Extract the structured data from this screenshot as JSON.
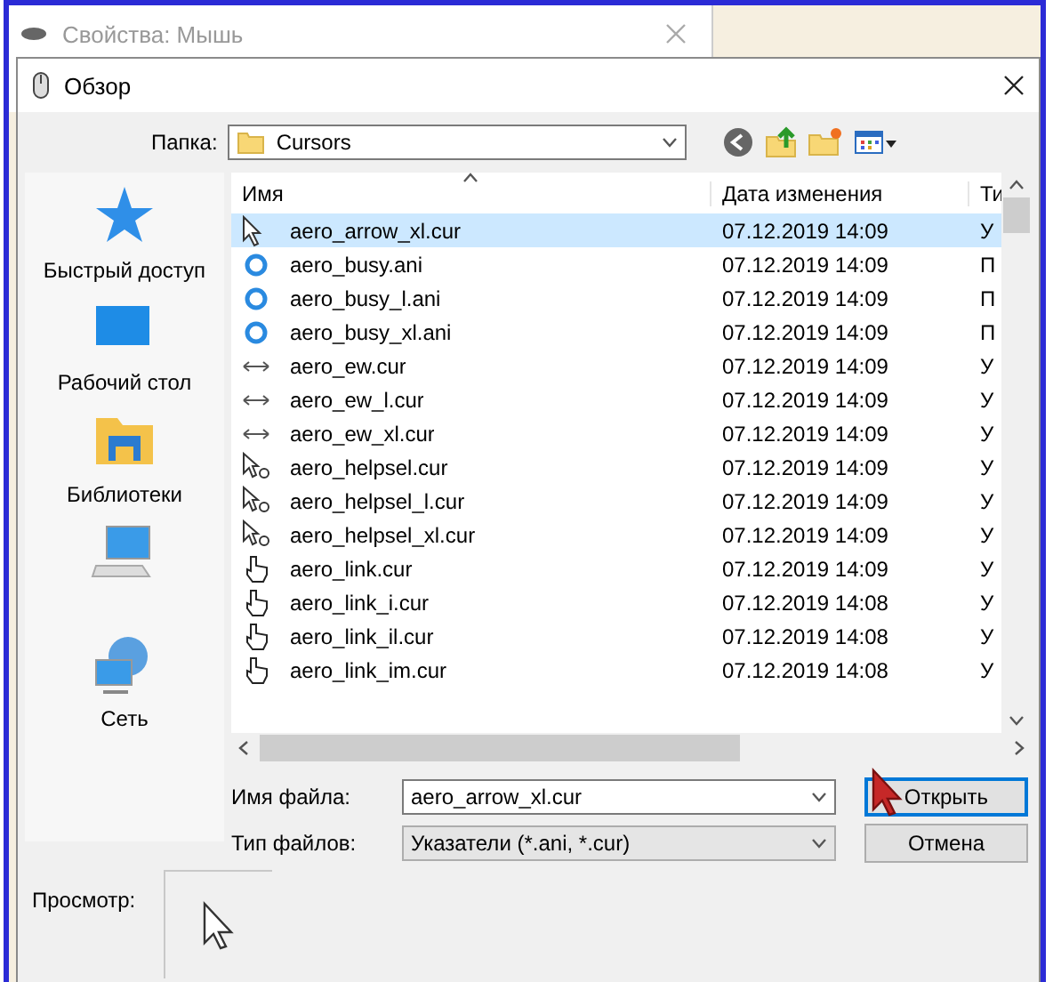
{
  "background_window": {
    "title": "Свойства: Мышь"
  },
  "dialog": {
    "title": "Обзор"
  },
  "folder": {
    "label": "Папка:",
    "value": "Cursors"
  },
  "places": [
    {
      "kind": "star",
      "label": "Быстрый доступ"
    },
    {
      "kind": "desktop",
      "label": "Рабочий стол"
    },
    {
      "kind": "libraries",
      "label": "Библиотеки"
    },
    {
      "kind": "computer"
    },
    {
      "kind": "network",
      "label": "Сеть"
    }
  ],
  "table": {
    "columns": [
      "Имя",
      "Дата изменения",
      "Ти"
    ],
    "rows": [
      {
        "kind": "arrow",
        "name": "aero_arrow_xl.cur",
        "date": "07.12.2019 14:09",
        "type": "У",
        "selected": true
      },
      {
        "kind": "busy",
        "name": "aero_busy.ani",
        "date": "07.12.2019 14:09",
        "type": "П",
        "selected": false
      },
      {
        "kind": "busy",
        "name": "aero_busy_l.ani",
        "date": "07.12.2019 14:09",
        "type": "П",
        "selected": false
      },
      {
        "kind": "busy",
        "name": "aero_busy_xl.ani",
        "date": "07.12.2019 14:09",
        "type": "П",
        "selected": false
      },
      {
        "kind": "ew",
        "name": "aero_ew.cur",
        "date": "07.12.2019 14:09",
        "type": "У",
        "selected": false
      },
      {
        "kind": "ew",
        "name": "aero_ew_l.cur",
        "date": "07.12.2019 14:09",
        "type": "У",
        "selected": false
      },
      {
        "kind": "ew",
        "name": "aero_ew_xl.cur",
        "date": "07.12.2019 14:09",
        "type": "У",
        "selected": false
      },
      {
        "kind": "helpsel",
        "name": "aero_helpsel.cur",
        "date": "07.12.2019 14:09",
        "type": "У",
        "selected": false
      },
      {
        "kind": "helpsel",
        "name": "aero_helpsel_l.cur",
        "date": "07.12.2019 14:09",
        "type": "У",
        "selected": false
      },
      {
        "kind": "helpsel",
        "name": "aero_helpsel_xl.cur",
        "date": "07.12.2019 14:09",
        "type": "У",
        "selected": false
      },
      {
        "kind": "link",
        "name": "aero_link.cur",
        "date": "07.12.2019 14:09",
        "type": "У",
        "selected": false
      },
      {
        "kind": "link",
        "name": "aero_link_i.cur",
        "date": "07.12.2019 14:08",
        "type": "У",
        "selected": false
      },
      {
        "kind": "link",
        "name": "aero_link_il.cur",
        "date": "07.12.2019 14:08",
        "type": "У",
        "selected": false
      },
      {
        "kind": "link",
        "name": "aero_link_im.cur",
        "date": "07.12.2019 14:08",
        "type": "У",
        "selected": false
      }
    ]
  },
  "file_name": {
    "label": "Имя файла:",
    "value": "aero_arrow_xl.cur"
  },
  "file_type": {
    "label": "Тип файлов:",
    "value": "Указатели (*.ani, *.cur)"
  },
  "buttons": [
    {
      "label": "Открыть",
      "default": true
    },
    {
      "label": "Отмена",
      "default": false
    }
  ],
  "preview": {
    "label": "Просмотр:"
  }
}
